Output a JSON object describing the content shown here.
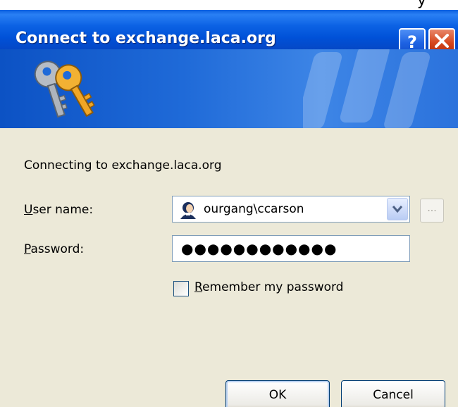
{
  "window": {
    "title": "Connect to exchange.laca.org",
    "top_fragment": "y"
  },
  "dialog": {
    "connecting_text": "Connecting to exchange.laca.org",
    "username": {
      "label_accel": "U",
      "label_rest": "ser name:",
      "value": "ourgang\\ccarson"
    },
    "password": {
      "label_accel": "P",
      "label_rest": "assword:",
      "masked_value": "●●●●●●●●●●●●"
    },
    "remember": {
      "label_accel": "R",
      "label_rest": "emember my password",
      "checked": false
    },
    "browse_label": "...",
    "ok_label": "OK",
    "cancel_label": "Cancel"
  },
  "icons": {
    "title_help": "help-icon",
    "title_close": "close-icon",
    "banner": "keys-icon",
    "user": "user-icon",
    "dropdown": "chevron-down-icon"
  },
  "colors": {
    "titlebar": "#0054e3",
    "accent_line": "#f08a23",
    "dialog_bg": "#ece9d8",
    "close_button": "#d5451b"
  }
}
